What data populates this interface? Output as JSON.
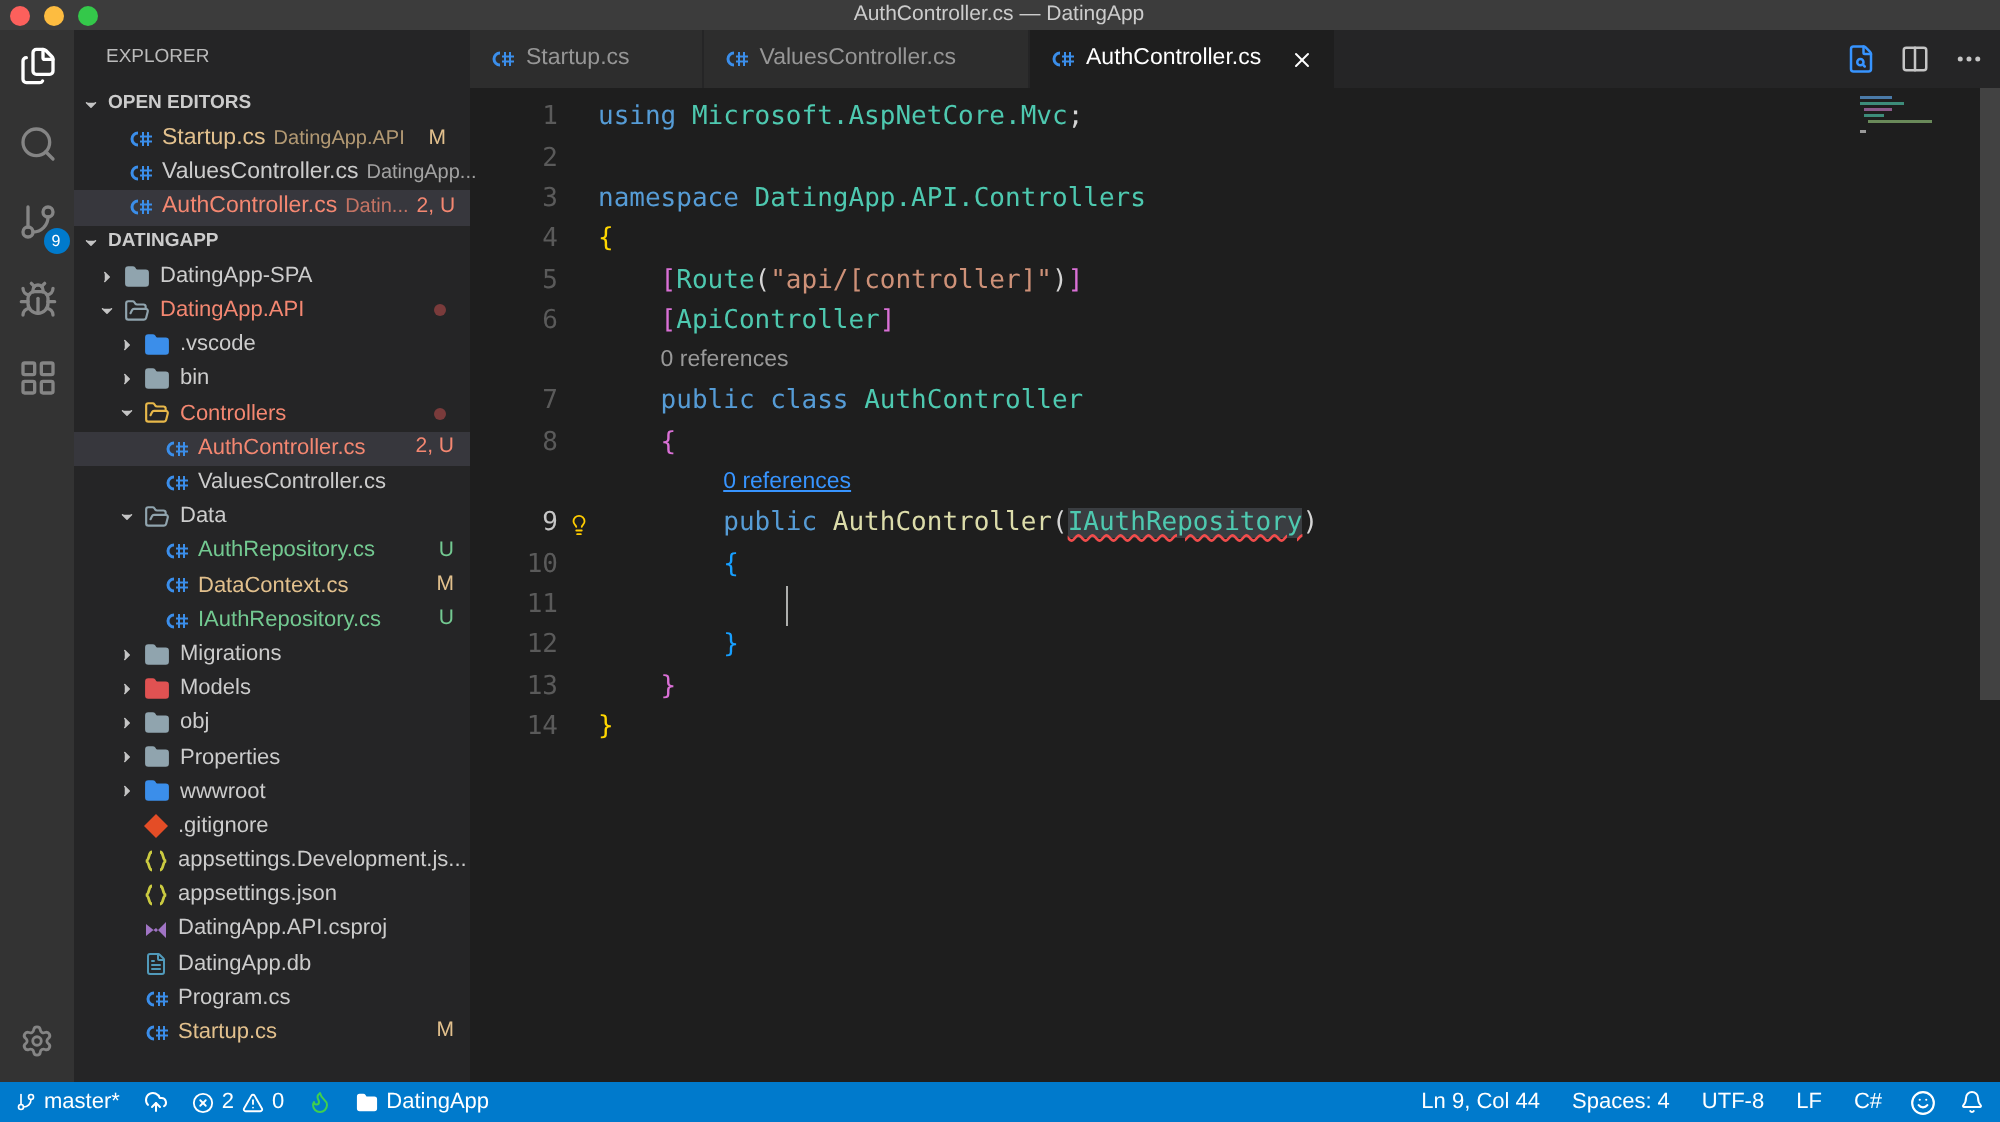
{
  "window": {
    "title": "AuthController.cs — DatingApp"
  },
  "activity_bar": {
    "scm_badge": "9"
  },
  "sidebar": {
    "title": "EXPLORER",
    "open_editors": {
      "label": "OPEN EDITORS",
      "expanded": true,
      "items": [
        {
          "name": "Startup.cs",
          "path": "DatingApp.API",
          "color": "#e2c08d",
          "badge": "M",
          "selected": false
        },
        {
          "name": "ValuesController.cs",
          "path": "DatingApp...",
          "selected": false
        },
        {
          "name": "AuthController.cs",
          "path": "Datin...",
          "color": "#f48771",
          "badge": "2, U",
          "selected": true
        }
      ]
    },
    "project": {
      "label": "DATINGAPP",
      "expanded": true,
      "items": [
        {
          "name": "DatingApp-SPA",
          "kind": "folder",
          "expanded": false,
          "selected": false
        },
        {
          "name": "DatingApp.API",
          "kind": "folder",
          "expanded": true,
          "color": "#f48771",
          "selected": false,
          "children": [
            {
              "name": ".vscode",
              "kind": "folder-blue",
              "expanded": false,
              "selected": false
            },
            {
              "name": "bin",
              "kind": "folder",
              "expanded": false,
              "selected": false
            },
            {
              "name": "Controllers",
              "kind": "folder-yellow",
              "expanded": true,
              "color": "#f48771",
              "selected": false,
              "children": [
                {
                  "name": "AuthController.cs",
                  "kind": "cs",
                  "color": "#f48771",
                  "badge": "2, U",
                  "selected": true
                },
                {
                  "name": "ValuesController.cs",
                  "kind": "cs",
                  "selected": false
                }
              ]
            },
            {
              "name": "Data",
              "kind": "folder",
              "expanded": true,
              "selected": false,
              "children": [
                {
                  "name": "AuthRepository.cs",
                  "kind": "cs",
                  "color": "#73c991",
                  "badge": "U",
                  "selected": false
                },
                {
                  "name": "DataContext.cs",
                  "kind": "cs",
                  "color": "#e2c08d",
                  "badge": "M",
                  "selected": false
                },
                {
                  "name": "IAuthRepository.cs",
                  "kind": "cs",
                  "color": "#73c991",
                  "badge": "U",
                  "selected": false
                }
              ]
            },
            {
              "name": "Migrations",
              "kind": "folder",
              "expanded": false,
              "selected": false
            },
            {
              "name": "Models",
              "kind": "folder-red",
              "expanded": false,
              "selected": false
            },
            {
              "name": "obj",
              "kind": "folder",
              "expanded": false,
              "selected": false
            },
            {
              "name": "Properties",
              "kind": "folder",
              "expanded": false,
              "selected": false
            },
            {
              "name": "wwwroot",
              "kind": "folder-blue",
              "expanded": false,
              "selected": false
            },
            {
              "name": ".gitignore",
              "kind": "git",
              "selected": false
            },
            {
              "name": "appsettings.Development.js...",
              "kind": "json",
              "selected": false
            },
            {
              "name": "appsettings.json",
              "kind": "json",
              "selected": false
            },
            {
              "name": "DatingApp.API.csproj",
              "kind": "csproj",
              "selected": false
            },
            {
              "name": "DatingApp.db",
              "kind": "db",
              "selected": false
            },
            {
              "name": "Program.cs",
              "kind": "cs",
              "selected": false
            },
            {
              "name": "Startup.cs",
              "kind": "cs",
              "color": "#e2c08d",
              "badge": "M",
              "selected": false
            }
          ]
        }
      ]
    }
  },
  "tabs": [
    {
      "label": "Startup.cs",
      "selected": false
    },
    {
      "label": "ValuesController.cs",
      "selected": false
    },
    {
      "label": "AuthController.cs",
      "selected": true
    }
  ],
  "editor": {
    "lines": [
      {
        "number": "1",
        "tokens": [
          {
            "kind": "kw",
            "s": "using "
          },
          {
            "kind": "type",
            "s": "Microsoft.AspNetCore.Mvc"
          },
          {
            "kind": "plain",
            "s": ";"
          }
        ]
      },
      {
        "number": "2"
      },
      {
        "number": "3",
        "tokens": [
          {
            "kind": "kw",
            "s": "namespace "
          },
          {
            "kind": "type",
            "s": "DatingApp.API.Controllers"
          }
        ]
      },
      {
        "number": "4",
        "tokens": [
          {
            "kind": "brace1",
            "s": "{"
          }
        ]
      },
      {
        "number": "5",
        "tokens": [
          {
            "kind": "brace2",
            "s": "    ["
          },
          {
            "kind": "type",
            "s": "Route"
          },
          {
            "kind": "plain",
            "s": "("
          },
          {
            "kind": "str",
            "s": "\"api/[controller]\""
          },
          {
            "kind": "plain",
            "s": ")"
          },
          {
            "kind": "brace2",
            "s": "]"
          }
        ]
      },
      {
        "number": "6",
        "tokens": [
          {
            "kind": "brace2",
            "s": "    ["
          },
          {
            "kind": "type",
            "s": "ApiController"
          },
          {
            "kind": "brace2",
            "s": "]"
          }
        ]
      },
      {
        "number": "7",
        "lens": {
          "text": "0 references",
          "link": false
        },
        "tokens": [
          {
            "kind": "kw",
            "s": "    public class "
          },
          {
            "kind": "type",
            "s": "AuthController"
          }
        ]
      },
      {
        "number": "8",
        "tokens": [
          {
            "kind": "brace2",
            "s": "    {"
          }
        ]
      },
      {
        "number": "9",
        "lens": {
          "text": "0 references",
          "link": true
        },
        "current": true,
        "bulb": true,
        "tokens": [
          {
            "kind": "kw",
            "s": "        public"
          },
          {
            "kind": "fn",
            "s": " AuthController"
          },
          {
            "kind": "plain",
            "s": "("
          },
          {
            "kind": "err",
            "s": "IAuthRepository"
          },
          {
            "kind": "plain",
            "s": ")"
          }
        ]
      },
      {
        "number": "10",
        "tokens": [
          {
            "kind": "brace3",
            "s": "        {"
          }
        ]
      },
      {
        "number": "11",
        "cursor": true
      },
      {
        "number": "12",
        "tokens": [
          {
            "kind": "brace3",
            "s": "        }"
          }
        ]
      },
      {
        "number": "13",
        "tokens": [
          {
            "kind": "brace2",
            "s": "    }"
          }
        ]
      },
      {
        "number": "14",
        "tokens": [
          {
            "kind": "brace1",
            "s": "}"
          }
        ]
      }
    ]
  },
  "status_bar": {
    "branch": "master*",
    "errors": "2",
    "warnings": "0",
    "folder": "DatingApp",
    "right": [
      "Ln 9, Col 44",
      "Spaces: 4",
      "UTF-8",
      "LF",
      "C#"
    ]
  }
}
